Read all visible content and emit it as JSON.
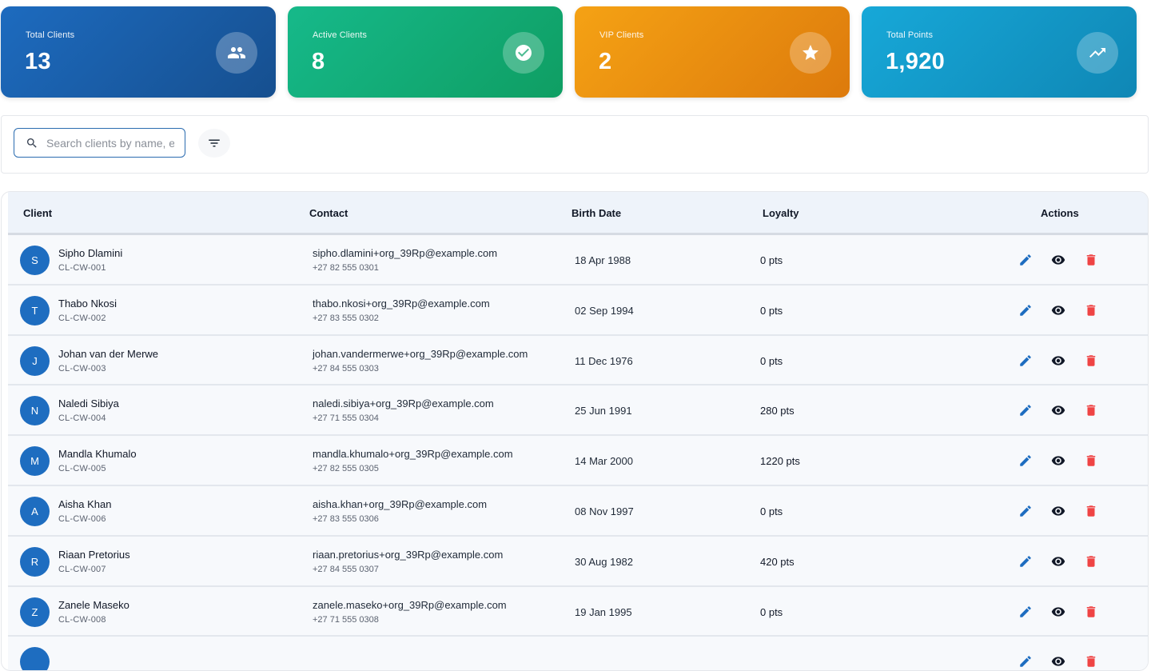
{
  "stats": [
    {
      "label": "Total Clients",
      "value": "13",
      "icon": "people-icon",
      "color": "#1a5fa8"
    },
    {
      "label": "Active Clients",
      "value": "8",
      "icon": "check-circle-icon",
      "color": "#12b27a"
    },
    {
      "label": "VIP Clients",
      "value": "2",
      "icon": "star-icon",
      "color": "#f19a12"
    },
    {
      "label": "Total Points",
      "value": "1,920",
      "icon": "trending-up-icon",
      "color": "#139fd2"
    }
  ],
  "search": {
    "placeholder": "Search clients by name, email, or phone",
    "value": ""
  },
  "table": {
    "headers": {
      "client": "Client",
      "contact": "Contact",
      "birth": "Birth Date",
      "loyalty": "Loyalty",
      "actions": "Actions"
    },
    "rows": [
      {
        "initial": "S",
        "name": "Sipho Dlamini",
        "id": "CL-CW-001",
        "email": "sipho.dlamini+org_39Rp@example.com",
        "phone": "+27 82 555 0301",
        "birth": "18 Apr 1988",
        "points": "0 pts"
      },
      {
        "initial": "T",
        "name": "Thabo Nkosi",
        "id": "CL-CW-002",
        "email": "thabo.nkosi+org_39Rp@example.com",
        "phone": "+27 83 555 0302",
        "birth": "02 Sep 1994",
        "points": "0 pts"
      },
      {
        "initial": "J",
        "name": "Johan van der Merwe",
        "id": "CL-CW-003",
        "email": "johan.vandermerwe+org_39Rp@example.com",
        "phone": "+27 84 555 0303",
        "birth": "11 Dec 1976",
        "points": "0 pts"
      },
      {
        "initial": "N",
        "name": "Naledi Sibiya",
        "id": "CL-CW-004",
        "email": "naledi.sibiya+org_39Rp@example.com",
        "phone": "+27 71 555 0304",
        "birth": "25 Jun 1991",
        "points": "280 pts"
      },
      {
        "initial": "M",
        "name": "Mandla Khumalo",
        "id": "CL-CW-005",
        "email": "mandla.khumalo+org_39Rp@example.com",
        "phone": "+27 82 555 0305",
        "birth": "14 Mar 2000",
        "points": "1220 pts"
      },
      {
        "initial": "A",
        "name": "Aisha Khan",
        "id": "CL-CW-006",
        "email": "aisha.khan+org_39Rp@example.com",
        "phone": "+27 83 555 0306",
        "birth": "08 Nov 1997",
        "points": "0 pts"
      },
      {
        "initial": "R",
        "name": "Riaan Pretorius",
        "id": "CL-CW-007",
        "email": "riaan.pretorius+org_39Rp@example.com",
        "phone": "+27 84 555 0307",
        "birth": "30 Aug 1982",
        "points": "420 pts"
      },
      {
        "initial": "Z",
        "name": "Zanele Maseko",
        "id": "CL-CW-008",
        "email": "zanele.maseko+org_39Rp@example.com",
        "phone": "+27 71 555 0308",
        "birth": "19 Jan 1995",
        "points": "0 pts"
      },
      {
        "initial": "",
        "name": "",
        "id": "",
        "email": "",
        "phone": "",
        "birth": "",
        "points": ""
      }
    ]
  }
}
